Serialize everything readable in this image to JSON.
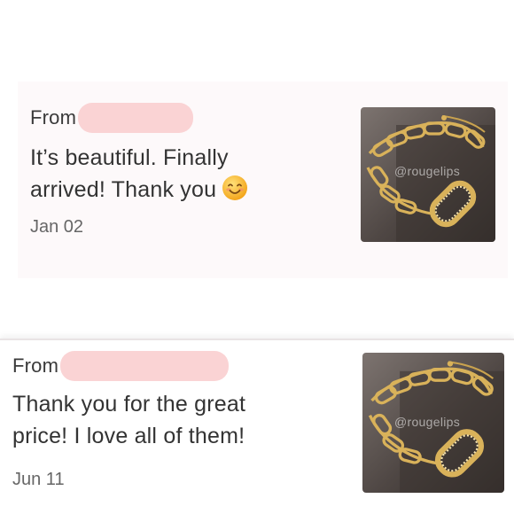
{
  "reviews": [
    {
      "from_label": "From",
      "message_line1": "It’s beautiful. Finally",
      "message_line2": "arrived! Thank you",
      "emoji": "smiling-face-icon",
      "date": "Jan 02",
      "watermark": "@rougelips"
    },
    {
      "from_label": "From",
      "message_line1": "Thank you for the great",
      "message_line2": "price! I love all of them!",
      "date": "Jun 11",
      "watermark": "@rougelips"
    }
  ],
  "colors": {
    "card_background": "#fdf9fa",
    "redaction": "#fad3d4",
    "text": "#333333",
    "date_text": "#666666",
    "gold": "#d9b25a"
  }
}
